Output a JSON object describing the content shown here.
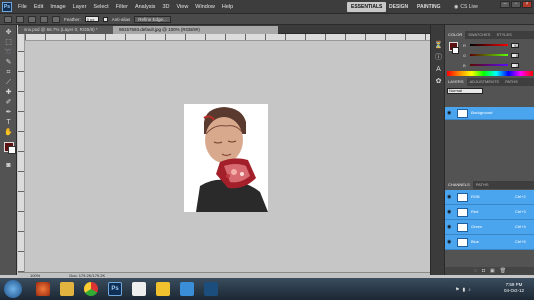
{
  "app": {
    "logo": "Ps",
    "menus": [
      "File",
      "Edit",
      "Image",
      "Layer",
      "Select",
      "Filter",
      "Analysis",
      "3D",
      "View",
      "Window",
      "Help"
    ],
    "workspaces": {
      "essentials": "ESSENTIALS",
      "design": "DESIGN",
      "painting": "PAINTING"
    },
    "cs_live": "CS Live",
    "accent": "#4aa5ee"
  },
  "options_bar": {
    "feather_label": "Feather:",
    "feather_value": "0 px",
    "antialias_label": "Anti-alias",
    "refine_edge": "Refine Edge..."
  },
  "documents": {
    "tab1": "sns.psd @ 66.7% (Layer 0, RGB/8) *",
    "tab2": "98157693.default.jpg @ 100% (RGB/8#)"
  },
  "status": {
    "zoom": "100%",
    "doc": "Doc: 179.2K/179.2K"
  },
  "panels": {
    "color_tabs": [
      "COLOR",
      "SWATCHES",
      "STYLES"
    ],
    "color": {
      "r": "91",
      "g": "8",
      "b": "1",
      "fg": "#5d1111"
    },
    "adjust_tabs": [
      "ADJUSTMENTS",
      "MASKS"
    ],
    "layers_tabs": [
      "LAYERS",
      "ADJUSTMENTS",
      "PATHS"
    ],
    "blend_mode": "Normal",
    "layers": [
      {
        "name": "Background"
      }
    ],
    "channels_tabs": [
      "CHANNELS",
      "PATHS"
    ],
    "channels": [
      {
        "name": "RGB",
        "shortcut": "Ctrl+2"
      },
      {
        "name": "Red",
        "shortcut": "Ctrl+3"
      },
      {
        "name": "Green",
        "shortcut": "Ctrl+4"
      },
      {
        "name": "Blue",
        "shortcut": "Ctrl+5"
      }
    ]
  },
  "taskbar": {
    "time": "7:59 PM",
    "date": "04-Oct-12"
  }
}
